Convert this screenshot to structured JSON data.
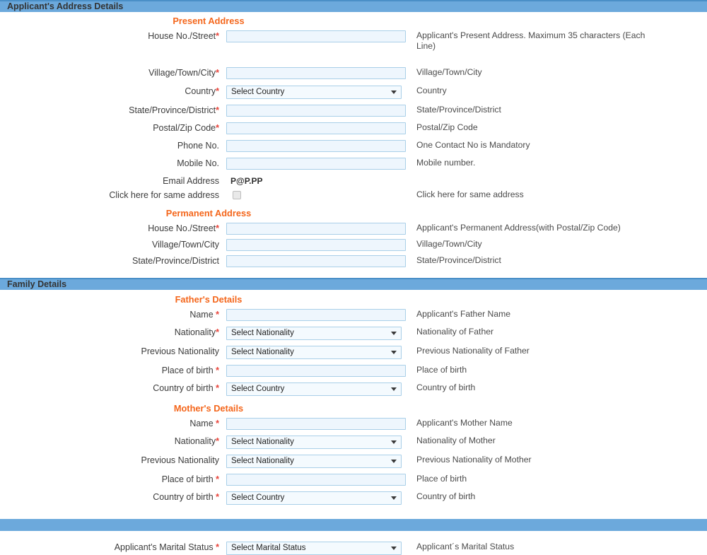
{
  "sections": {
    "address": {
      "title": "Applicant's Address Details"
    },
    "family": {
      "title": "Family Details"
    },
    "marital": {
      "title": ""
    }
  },
  "present_address": {
    "heading": "Present Address",
    "rows": [
      {
        "label": "House No./Street",
        "required": true,
        "star_space": false,
        "control": "text",
        "value": "",
        "help": "Applicant's Present Address. Maximum 35 characters (Each Line)"
      },
      {
        "label": "Village/Town/City",
        "required": true,
        "star_space": false,
        "control": "text",
        "value": "",
        "help": "Village/Town/City"
      },
      {
        "label": "Country",
        "required": true,
        "star_space": false,
        "control": "select",
        "value": "Select Country",
        "help": "Country"
      },
      {
        "label": "State/Province/District",
        "required": true,
        "star_space": false,
        "control": "text",
        "value": "",
        "help": "State/Province/District"
      },
      {
        "label": "Postal/Zip Code",
        "required": true,
        "star_space": false,
        "control": "text",
        "value": "",
        "help": "Postal/Zip Code"
      },
      {
        "label": "Phone No.",
        "required": false,
        "star_space": false,
        "control": "text",
        "value": "",
        "help": "One Contact No is Mandatory"
      },
      {
        "label": "Mobile No.",
        "required": false,
        "star_space": false,
        "control": "text",
        "value": "",
        "help": "Mobile number."
      },
      {
        "label": "Email Address",
        "required": false,
        "star_space": false,
        "control": "static",
        "value": "P@P.PP",
        "help": ""
      },
      {
        "label": "Click here for same address",
        "required": false,
        "star_space": false,
        "control": "checkbox",
        "value": "",
        "help": "Click here for same address"
      }
    ]
  },
  "permanent_address": {
    "heading": "Permanent Address",
    "rows": [
      {
        "label": "House No./Street",
        "required": true,
        "star_space": false,
        "control": "text",
        "value": "",
        "help": "Applicant's Permanent Address(with Postal/Zip Code)"
      },
      {
        "label": "Village/Town/City",
        "required": false,
        "star_space": false,
        "control": "text",
        "value": "",
        "help": "Village/Town/City"
      },
      {
        "label": "State/Province/District",
        "required": false,
        "star_space": false,
        "control": "text",
        "value": "",
        "help": "State/Province/District"
      }
    ]
  },
  "fathers_details": {
    "heading": "Father's Details",
    "rows": [
      {
        "label": "Name",
        "required": true,
        "star_space": true,
        "control": "text",
        "value": "",
        "help": "Applicant's Father Name"
      },
      {
        "label": "Nationality",
        "required": true,
        "star_space": false,
        "control": "select",
        "value": "Select Nationality",
        "help": "Nationality of Father"
      },
      {
        "label": "Previous Nationality",
        "required": false,
        "star_space": false,
        "control": "select",
        "value": "Select Nationality",
        "help": "Previous Nationality of Father"
      },
      {
        "label": "Place of birth",
        "required": true,
        "star_space": true,
        "control": "text",
        "value": "",
        "help": "Place of birth"
      },
      {
        "label": "Country of birth",
        "required": true,
        "star_space": true,
        "control": "select",
        "value": "Select Country",
        "help": "Country of birth"
      }
    ]
  },
  "mothers_details": {
    "heading": "Mother's Details",
    "rows": [
      {
        "label": "Name",
        "required": true,
        "star_space": true,
        "control": "text",
        "value": "",
        "help": "Applicant's Mother Name"
      },
      {
        "label": "Nationality",
        "required": true,
        "star_space": false,
        "control": "select",
        "value": "Select Nationality",
        "help": "Nationality of Mother"
      },
      {
        "label": "Previous Nationality",
        "required": false,
        "star_space": false,
        "control": "select",
        "value": "Select Nationality",
        "help": "Previous Nationality of Mother"
      },
      {
        "label": "Place of birth",
        "required": true,
        "star_space": true,
        "control": "text",
        "value": "",
        "help": "Place of birth"
      },
      {
        "label": "Country of birth",
        "required": true,
        "star_space": true,
        "control": "select",
        "value": "Select Country",
        "help": "Country of birth"
      }
    ]
  },
  "marital_details": {
    "rows": [
      {
        "label": "Applicant's Marital Status",
        "required": true,
        "star_space": true,
        "control": "select",
        "value": "Select Marital Status",
        "help": "Applicant´s Marital Status"
      }
    ]
  },
  "colors": {
    "section_bar": "#6ca9dc",
    "section_bar_border": "#4a8fc7",
    "subheading": "#f4661b",
    "required_star": "#e8453c",
    "field_bg": "#eef6fd",
    "field_border": "#a9cfe8"
  }
}
